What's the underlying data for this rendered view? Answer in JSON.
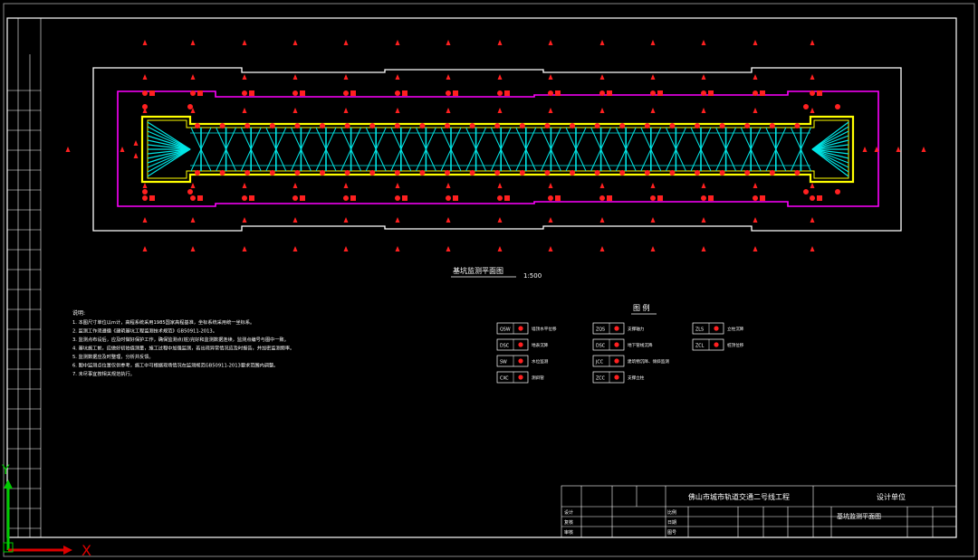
{
  "drawing": {
    "plan_title": "基坑监测平面图",
    "plan_scale": "1:500",
    "legend_title": "图 例",
    "notes_heading": "说明:",
    "notes": [
      "1. 本图尺寸单位以m计，高程系统采用1985国家高程基准，坐标系统采用统一坐标系。",
      "2. 监测工作须遵循《建筑基坑工程监测技术规范》GB50911-2013。",
      "3. 监测点布设后，应及时做好保护工作，确保监测点(桩)完好和监测数据连续，监测点编号与图中一致。",
      "4. 基坑施工前，应做好初始值测量，施工过程中加强监测，若出现异常情况应及时报告，并加密监测频率。",
      "5. 监测数据应及时整理，分析并反馈。",
      "6. 图中监测点位置仅供参考，施工中可根据现场情况在监测规范GB50911-2013要求范围内调整。",
      "7. 未尽事宜按相关规范执行。"
    ],
    "legend_items": [
      {
        "code": "QSW",
        "desc": "墙顶水平位移"
      },
      {
        "code": "ZQS",
        "desc": "支撑轴力"
      },
      {
        "code": "DSC",
        "desc": "地表沉降"
      },
      {
        "code": "DSC",
        "desc": "地下管线沉降"
      },
      {
        "code": "SW",
        "desc": "水位监测"
      },
      {
        "code": "JCC",
        "desc": "建筑物沉降、倾斜监测"
      },
      {
        "code": "ZLS",
        "desc": "立柱沉降"
      },
      {
        "code": "CXC",
        "desc": "测斜管"
      },
      {
        "code": "ZCC",
        "desc": "支撑立柱"
      },
      {
        "code": "ZCL",
        "desc": "桩顶位移"
      }
    ]
  },
  "title_block": {
    "project": "佛山市城市轨道交通二号线工程",
    "drawing_name": "基坑监测平面图",
    "design_unit": "设计单位",
    "cells": [
      "设计",
      "复核",
      "审核",
      "比例",
      "日期",
      "图号"
    ]
  },
  "ucs": {
    "x_label": "X",
    "y_label": "Y"
  },
  "colors": {
    "background": "#000000",
    "frame": "#ffffff",
    "boundary_magenta": "#ff00ff",
    "pit_yellow": "#ffff00",
    "struts_cyan": "#00e5e5",
    "markers_red": "#ff2020",
    "ucs_green": "#00cc00",
    "ucs_red": "#dd0000"
  }
}
